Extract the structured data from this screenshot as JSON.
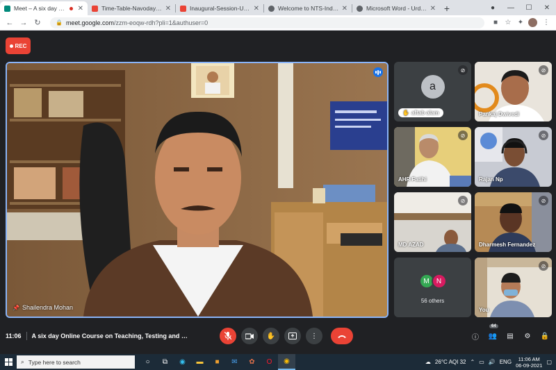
{
  "browser": {
    "tabs": [
      {
        "title": "Meet – A six day Online Cou",
        "favicon_color": "#00897b",
        "active": true,
        "recording": true
      },
      {
        "title": "Time-Table-Navodaya_Urdu-06-",
        "favicon_color": "#ea4335"
      },
      {
        "title": "Inaugural-Session-Urdu.pdf",
        "favicon_color": "#ea4335"
      },
      {
        "title": "Welcome to NTS-India Website",
        "favicon_color": "#5f6368"
      },
      {
        "title": "Microsoft Word - Urdu Website |",
        "favicon_color": "#5f6368"
      }
    ],
    "new_tab_label": "+",
    "url_host": "meet.google.com",
    "url_path": "/zzm-eoqw-rdh?pli=1&authuser=0"
  },
  "meet": {
    "rec_label": "REC",
    "main_speaker": "Shailendra Mohan",
    "participants": [
      {
        "name": "aftab alam",
        "avatar_letter": "a",
        "muted": true
      },
      {
        "name": "Pankaj Dwivedi",
        "muted": true
      },
      {
        "name": "AHR Fatihi",
        "muted": true
      },
      {
        "name": "Rajan Np",
        "muted": true
      },
      {
        "name": "MD AZAD",
        "muted": true
      },
      {
        "name": "Dharmesh Fernandez",
        "muted": true
      },
      {
        "name": "You",
        "muted": true
      }
    ],
    "others": {
      "letters": [
        "M",
        "N"
      ],
      "colors": [
        "#34a853",
        "#d81b60"
      ],
      "label": "56 others"
    },
    "time": "11:06",
    "title": "A six day Online Course on Teaching, Testing and Ev...",
    "people_count": "64"
  },
  "taskbar": {
    "search_placeholder": "Type here to search",
    "weather": "26°C  AQI 32",
    "lang": "ENG",
    "time": "11:06 AM",
    "date": "06-09-2021"
  }
}
